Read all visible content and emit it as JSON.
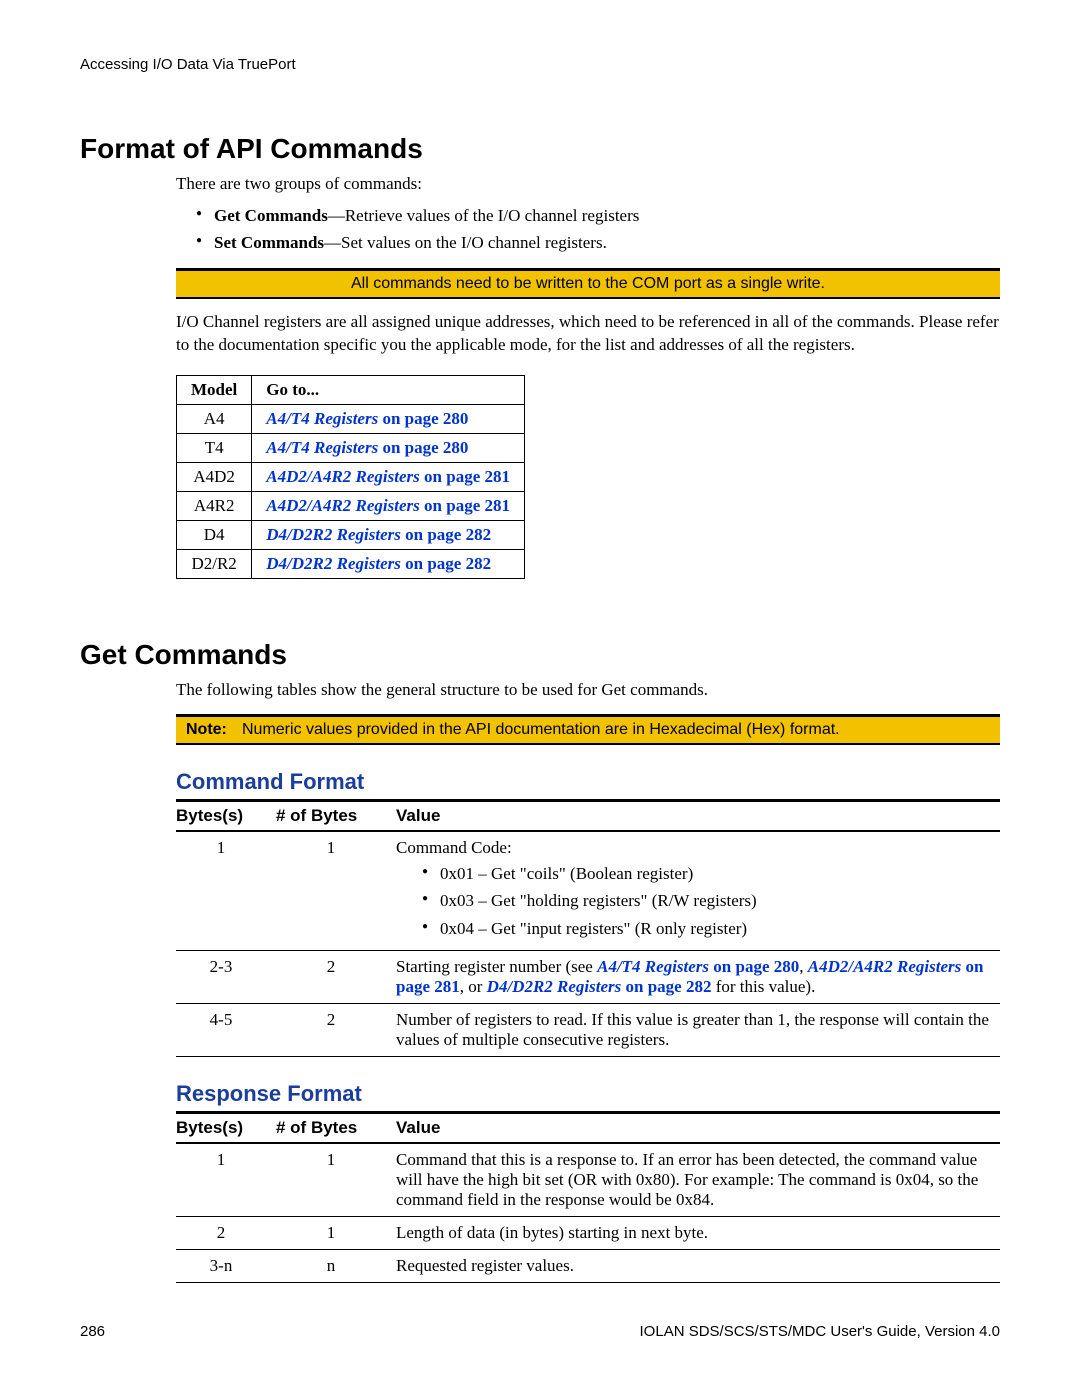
{
  "runningHead": "Accessing I/O Data Via TruePort",
  "section1": {
    "title": "Format of API Commands",
    "intro": "There are two groups of commands:",
    "bullets": [
      {
        "bold": "Get Commands",
        "rest": "—Retrieve values of the I/O channel registers"
      },
      {
        "bold": "Set Commands",
        "rest": "—Set values on the I/O channel registers."
      }
    ],
    "noteCentered": "All commands need to be written to the COM port as a single write.",
    "para2": "I/O Channel registers are all assigned unique addresses, which need to be referenced in all of the commands. Please refer to the documentation specific you the applicable mode, for the list and addresses of all the registers.",
    "tableHead": {
      "model": "Model",
      "goto": "Go to..."
    },
    "rows": [
      {
        "model": "A4",
        "linkItalic": "A4/T4 Registers",
        "linkPage": " on page 280"
      },
      {
        "model": "T4",
        "linkItalic": "A4/T4 Registers",
        "linkPage": " on page 280"
      },
      {
        "model": "A4D2",
        "linkItalic": "A4D2/A4R2 Registers",
        "linkPage": " on page 281"
      },
      {
        "model": "A4R2",
        "linkItalic": "A4D2/A4R2 Registers",
        "linkPage": " on page 281"
      },
      {
        "model": "D4",
        "linkItalic": "D4/D2R2 Registers",
        "linkPage": " on page 282"
      },
      {
        "model": "D2/R2",
        "linkItalic": "D4/D2R2 Registers",
        "linkPage": " on page 282"
      }
    ]
  },
  "section2": {
    "title": "Get Commands",
    "intro": "The following tables show the general structure to be used for Get commands.",
    "noteLabel": "Note:",
    "noteText": "Numeric values provided in the API documentation are in Hexadecimal (Hex) format.",
    "cmdFormatTitle": "Command Format",
    "byteHead": {
      "bytes": "Bytes(s)",
      "num": "# of Bytes",
      "value": "Value"
    },
    "cmdRows": {
      "r1": {
        "bytes": "1",
        "num": "1",
        "lead": "Command Code:",
        "b1": "0x01 – Get \"coils\" (Boolean register)",
        "b2": "0x03 – Get \"holding registers\" (R/W registers)",
        "b3": "0x04 – Get \"input registers\" (R only register)"
      },
      "r2": {
        "bytes": "2-3",
        "num": "2",
        "pre": "Starting register number (see ",
        "l1i": "A4/T4 Registers",
        "l1p": " on page 280",
        "sep1": ", ",
        "l2i": "A4D2/A4R2 Registers",
        "l2p": " on page 281",
        "sep2": ", or ",
        "l3i": "D4/D2R2 Registers",
        "l3p": " on page 282",
        "tail": " for this value)."
      },
      "r3": {
        "bytes": "4-5",
        "num": "2",
        "text": "Number of registers to read. If this value is greater than 1, the response will contain the values of multiple consecutive registers."
      }
    },
    "respFormatTitle": "Response Format",
    "respRows": {
      "r1": {
        "bytes": "1",
        "num": "1",
        "text": "Command that this is a response to. If an error has been detected, the command value will have the high bit set (OR with 0x80). For example: The command is 0x04, so the command field in the response would be 0x84."
      },
      "r2": {
        "bytes": "2",
        "num": "1",
        "text": "Length of data (in bytes) starting in next byte."
      },
      "r3": {
        "bytes": "3-n",
        "num": "n",
        "text": "Requested register values."
      }
    }
  },
  "footer": {
    "pageNum": "286",
    "guide": "IOLAN SDS/SCS/STS/MDC User's Guide, Version 4.0"
  }
}
